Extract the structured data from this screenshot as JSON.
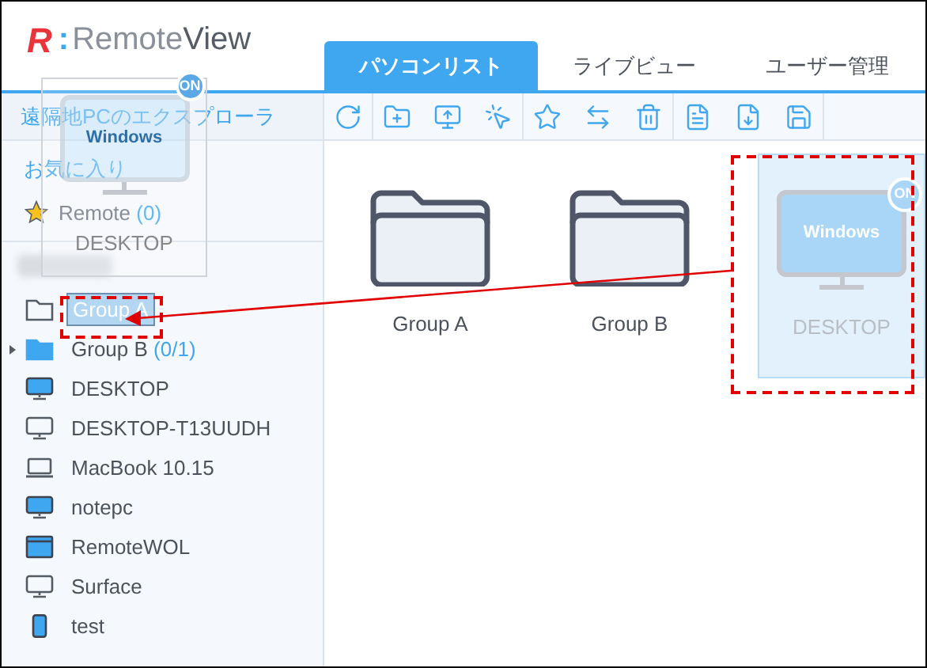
{
  "logo": {
    "mark": "R",
    "separator": ":",
    "name_light": "Remote",
    "name_bold": "View"
  },
  "tabs": [
    {
      "label": "パソコンリスト",
      "selected": true
    },
    {
      "label": "ライブビュー",
      "selected": false
    },
    {
      "label": "ユーザー管理",
      "selected": false
    }
  ],
  "sidebar": {
    "explorer_link": "遠隔地PCのエクスプローラ",
    "favorites_title": "お気に入り",
    "favorites": [
      {
        "label": "Remote",
        "count": "(0)"
      }
    ],
    "items": [
      {
        "kind": "folder",
        "label": "Group A",
        "online": false,
        "selected": true,
        "expandable": false
      },
      {
        "kind": "folder",
        "label": "Group B",
        "count": "(0/1)",
        "online": true,
        "selected": false,
        "expandable": true
      },
      {
        "kind": "monitor",
        "label": "DESKTOP",
        "online": true,
        "selected": false,
        "expandable": false
      },
      {
        "kind": "monitor",
        "label": "DESKTOP-T13UUDH",
        "online": false,
        "selected": false,
        "expandable": false
      },
      {
        "kind": "laptop",
        "label": "MacBook 10.15",
        "online": false,
        "selected": false,
        "expandable": false
      },
      {
        "kind": "monitor",
        "label": "notepc",
        "online": true,
        "selected": false,
        "expandable": false
      },
      {
        "kind": "server",
        "label": "RemoteWOL",
        "online": true,
        "selected": false,
        "expandable": false
      },
      {
        "kind": "monitor",
        "label": "Surface",
        "online": false,
        "selected": false,
        "expandable": false
      },
      {
        "kind": "tablet",
        "label": "test",
        "online": true,
        "selected": false,
        "expandable": false
      }
    ]
  },
  "tiles": [
    {
      "kind": "folder",
      "label": "Group A",
      "selected": false
    },
    {
      "kind": "folder",
      "label": "Group B",
      "selected": false
    },
    {
      "kind": "pc",
      "label": "DESKTOP",
      "screen_label": "Windows",
      "badge": "ON",
      "selected": true
    }
  ],
  "drag_ghost": {
    "screen_label": "Windows",
    "badge": "ON",
    "label": "DESKTOP"
  }
}
